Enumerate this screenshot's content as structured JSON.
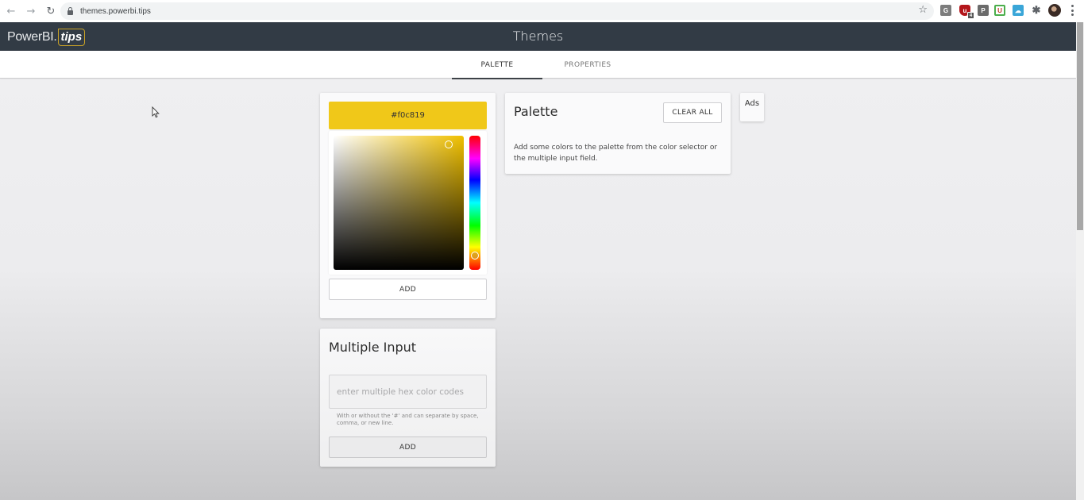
{
  "browser": {
    "url": "themes.powerbi.tips",
    "nav": {
      "back_icon": "arrow-left-icon",
      "forward_icon": "arrow-right-icon",
      "reload_icon": "reload-icon"
    },
    "extensions": [
      {
        "name": "grammarly-extension",
        "label": "G"
      },
      {
        "name": "shield-extension",
        "label": "u",
        "badge": "4"
      },
      {
        "name": "pocket-extension",
        "label": "P"
      },
      {
        "name": "calendar-extension",
        "label": "U"
      },
      {
        "name": "cloud-extension",
        "label": "☁"
      },
      {
        "name": "extensions-puzzle",
        "label": "✱"
      }
    ]
  },
  "app": {
    "logo_text": "PowerBI.",
    "logo_tips": "tips",
    "title": "Themes",
    "brand_header_color": "#323b45"
  },
  "tabs": [
    {
      "label": "PALETTE",
      "active": true
    },
    {
      "label": "PROPERTIES",
      "active": false
    }
  ],
  "color_picker": {
    "hex_value": "#f0c819",
    "swatch_color": "#f0c819",
    "hue_degrees": 49,
    "saturation_pct": 90,
    "value_pct": 94,
    "add_label": "ADD"
  },
  "multiple_input": {
    "title": "Multiple Input",
    "value": "",
    "placeholder": "enter multiple hex color codes",
    "help_text": "With or without the '#' and can separate by space, comma, or new line.",
    "add_label": "ADD"
  },
  "palette": {
    "title": "Palette",
    "clear_label": "CLEAR ALL",
    "empty_message": "Add some colors to the palette from the color selector or the multiple input field.",
    "colors": []
  },
  "ads": {
    "label": "Ads"
  }
}
